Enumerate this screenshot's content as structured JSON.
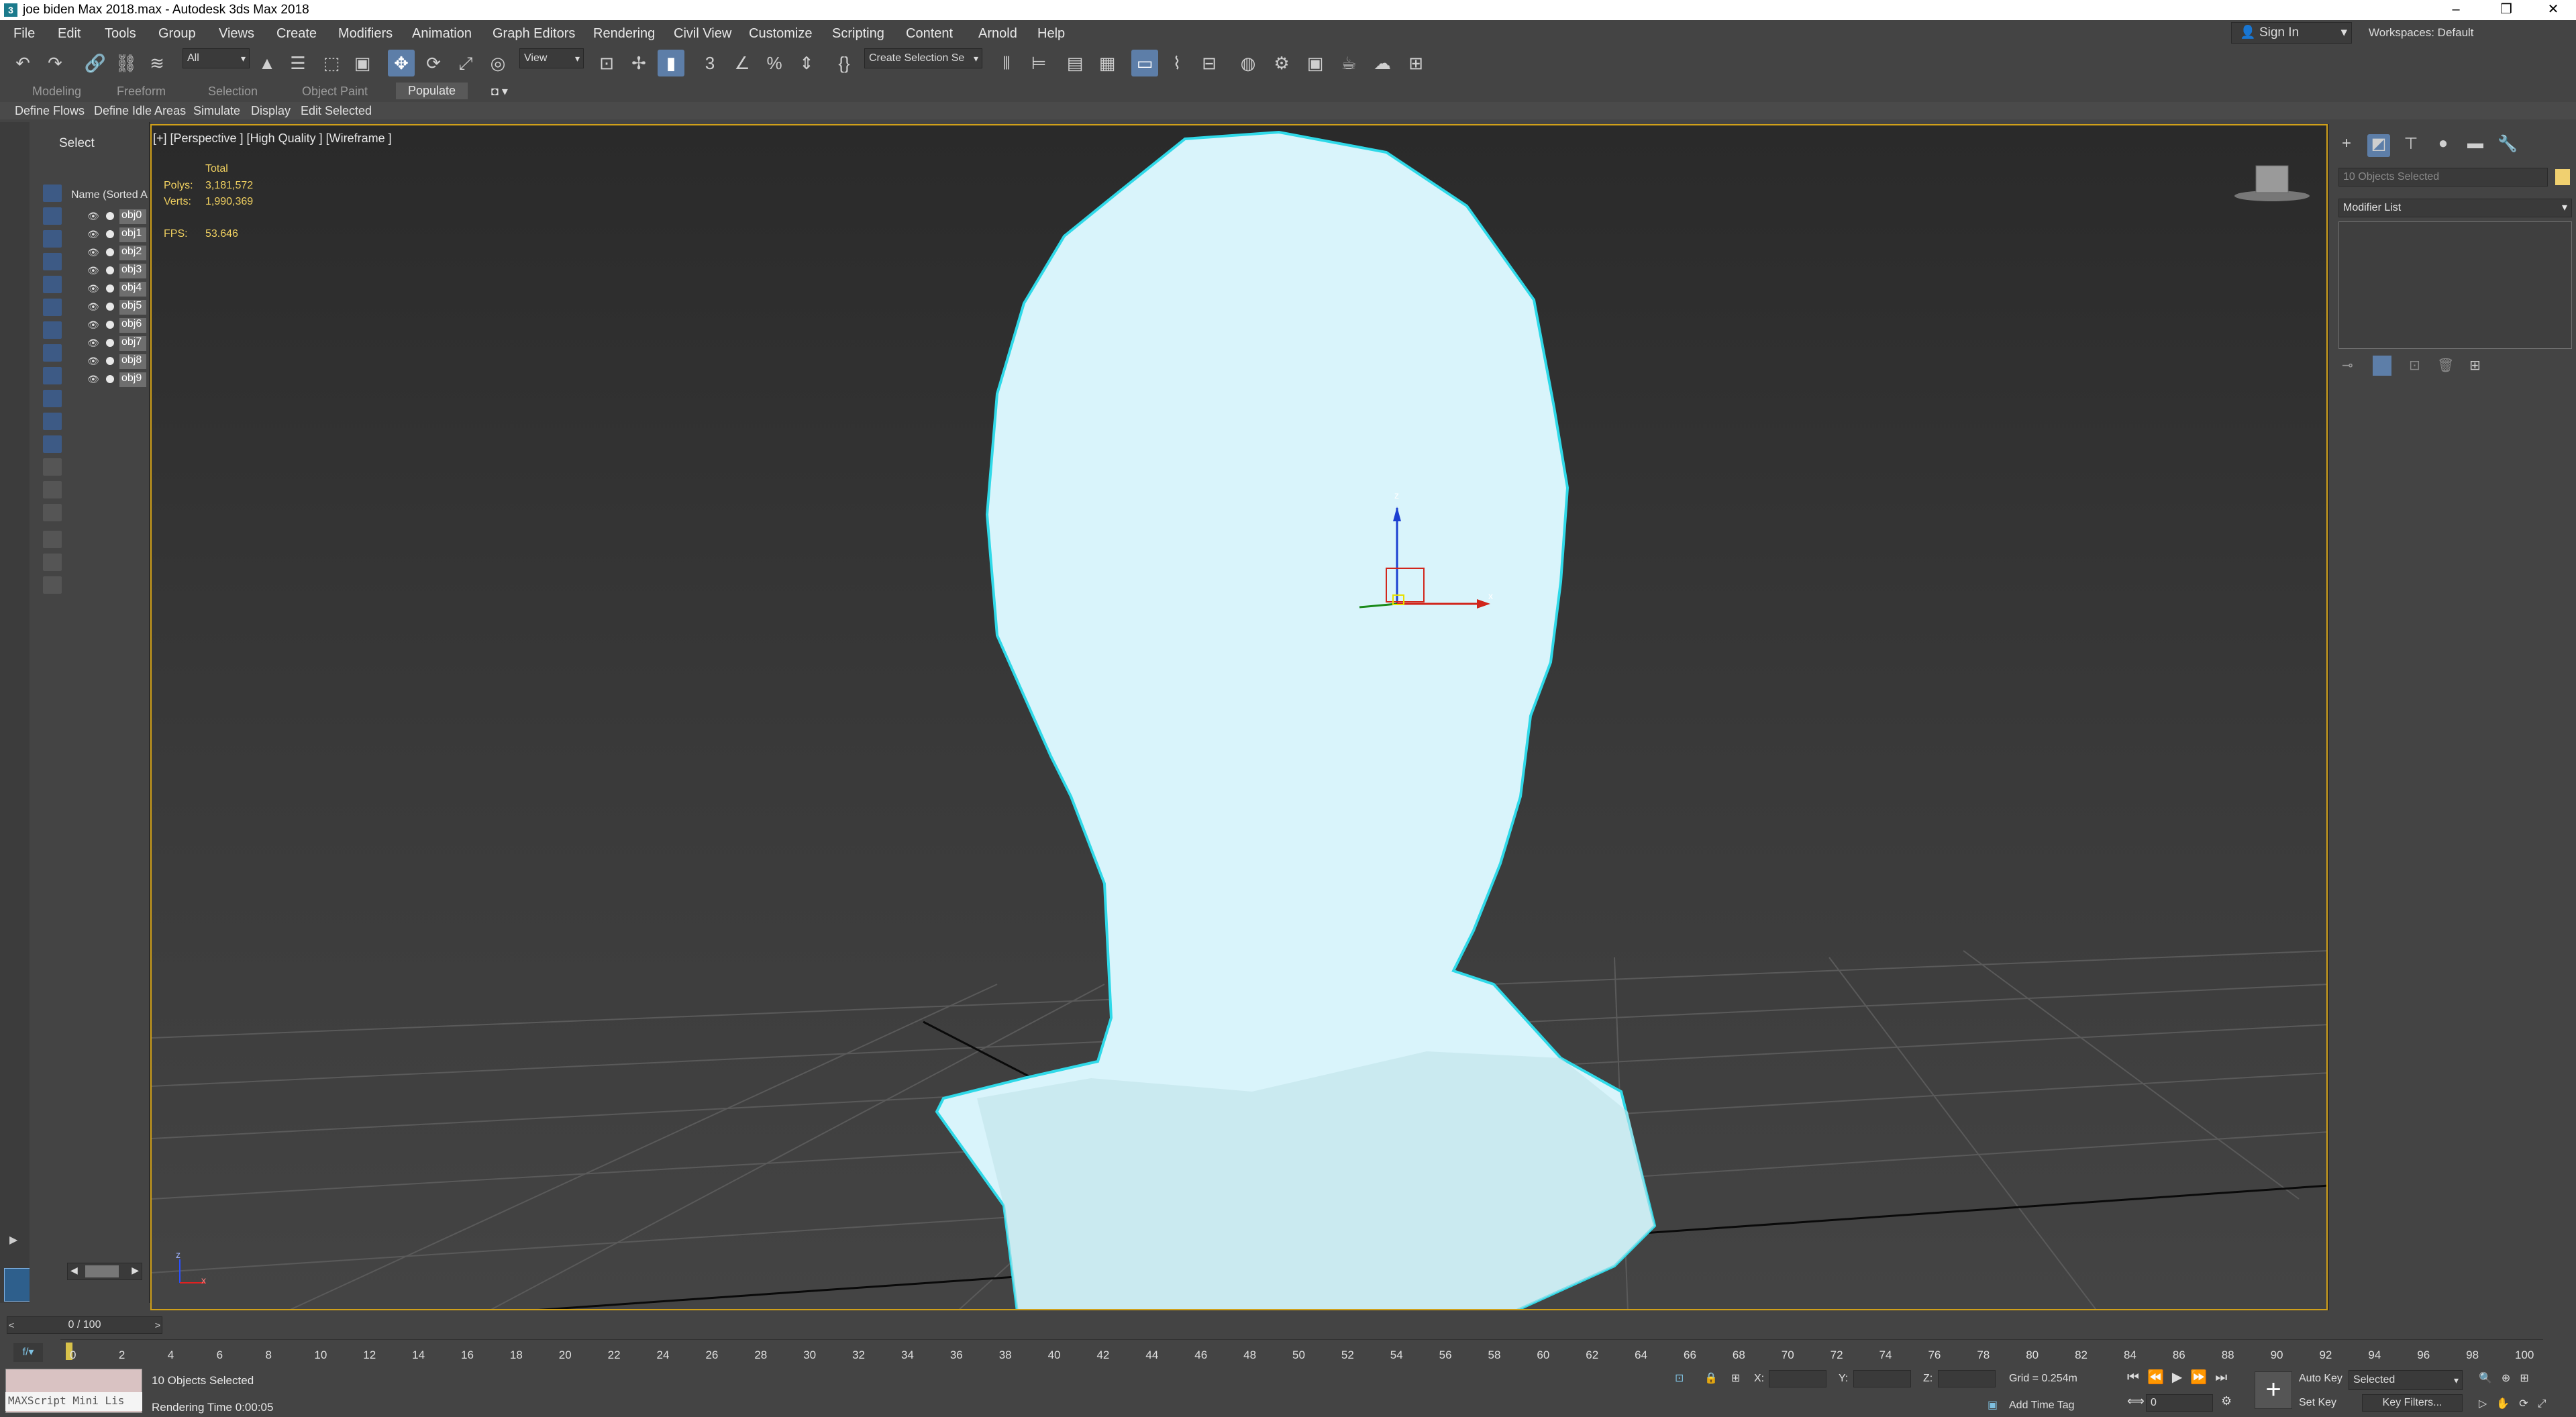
{
  "window": {
    "title": "joe biden Max 2018.max - Autodesk 3ds Max 2018",
    "app_icon": "3"
  },
  "menu": [
    "File",
    "Edit",
    "Tools",
    "Group",
    "Views",
    "Create",
    "Modifiers",
    "Animation",
    "Graph Editors",
    "Rendering",
    "Civil View",
    "Customize",
    "Scripting",
    "Content",
    "Arnold",
    "Help"
  ],
  "account": {
    "sign_in": "Sign In",
    "workspaces": "Workspaces: Default"
  },
  "toolbar": {
    "filter": "All",
    "ref_coord": "View",
    "named_selection": "Create Selection Se"
  },
  "ribbon": {
    "tabs": [
      "Modeling",
      "Freeform",
      "Selection",
      "Object Paint",
      "Populate"
    ],
    "active_tab": "Populate",
    "subtabs": [
      "Define Flows",
      "Define Idle Areas",
      "Simulate",
      "Display",
      "Edit Selected"
    ]
  },
  "explorer": {
    "title": "Select",
    "column": "Name (Sorted A",
    "objects": [
      "obj0",
      "obj1",
      "obj2",
      "obj3",
      "obj4",
      "obj5",
      "obj6",
      "obj7",
      "obj8",
      "obj9"
    ]
  },
  "viewport": {
    "label": "[+] [Perspective ] [High Quality ] [Wireframe ]",
    "stats": {
      "total": "Total",
      "polys_label": "Polys:",
      "polys": "3,181,572",
      "verts_label": "Verts:",
      "verts": "1,990,369",
      "fps_label": "FPS:",
      "fps": "53.646"
    },
    "gizmo_z": "z",
    "gizmo_x": "x",
    "axis_z": "z",
    "axis_x": "x"
  },
  "command_panel": {
    "selection": "10 Objects Selected",
    "modifier_list": "Modifier List"
  },
  "timeline": {
    "slider": "0 / 100",
    "ticks": [
      "0",
      "2",
      "4",
      "6",
      "8",
      "10",
      "12",
      "14",
      "16",
      "18",
      "20",
      "22",
      "24",
      "26",
      "28",
      "30",
      "32",
      "34",
      "36",
      "38",
      "40",
      "42",
      "44",
      "46",
      "48",
      "50",
      "52",
      "54",
      "56",
      "58",
      "60",
      "62",
      "64",
      "66",
      "68",
      "70",
      "72",
      "74",
      "76",
      "78",
      "80",
      "82",
      "84",
      "86",
      "88",
      "90",
      "92",
      "94",
      "96",
      "98",
      "100"
    ]
  },
  "status": {
    "maxscript": "MAXScript Mini Lis",
    "selected": "10 Objects Selected",
    "render_time": "Rendering Time  0:00:05",
    "x_label": "X:",
    "y_label": "Y:",
    "z_label": "Z:",
    "grid": "Grid = 0.254m",
    "add_time_tag": "Add Time Tag",
    "auto_key": "Auto Key",
    "set_key": "Set Key",
    "key_mode": "Selected",
    "key_filters": "Key Filters...",
    "frame": "0"
  },
  "colors": {
    "viewport_border": "#d0a01a",
    "mesh": "#d8f4fb",
    "mesh_outline": "#30d8e8",
    "stats": "#f0d060",
    "active_tool": "#5d7ea8"
  }
}
